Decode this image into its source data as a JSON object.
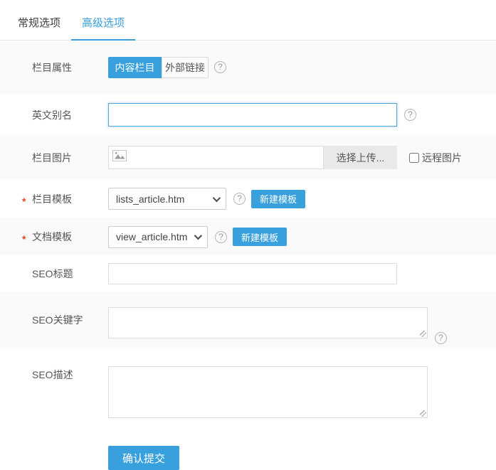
{
  "tabs": {
    "items": [
      {
        "label": "常规选项"
      },
      {
        "label": "高级选项"
      }
    ],
    "active_index": 1
  },
  "icons": {
    "help": "?"
  },
  "rows": {
    "attribute": {
      "label": "栏目属性",
      "options": [
        {
          "label": "内容栏目",
          "selected": true
        },
        {
          "label": "外部链接",
          "selected": false
        }
      ],
      "selected": "内容栏目"
    },
    "alias": {
      "label": "英文别名",
      "value": "",
      "placeholder": ""
    },
    "image": {
      "label": "栏目图片",
      "value": "",
      "upload_button": "选择上传...",
      "remote_label": "远程图片",
      "remote_checked": false
    },
    "list_template": {
      "label": "栏目模板",
      "required": "*",
      "value": "lists_article.htm",
      "new_button": "新建模板"
    },
    "doc_template": {
      "label": "文档模板",
      "required": "*",
      "value": "view_article.htm",
      "new_button": "新建模板"
    },
    "seo_title": {
      "label": "SEO标题",
      "value": "",
      "placeholder": ""
    },
    "seo_keywords": {
      "label": "SEO关键字",
      "value": "",
      "placeholder": ""
    },
    "seo_desc": {
      "label": "SEO描述",
      "value": "",
      "placeholder": ""
    }
  },
  "submit": {
    "label": "确认提交"
  },
  "colors": {
    "accent": "#38a0dc",
    "focus_border": "#54a7d9",
    "row_alt_bg": "#fafafa",
    "input_border": "#dddddd",
    "required": "#e8471d"
  }
}
